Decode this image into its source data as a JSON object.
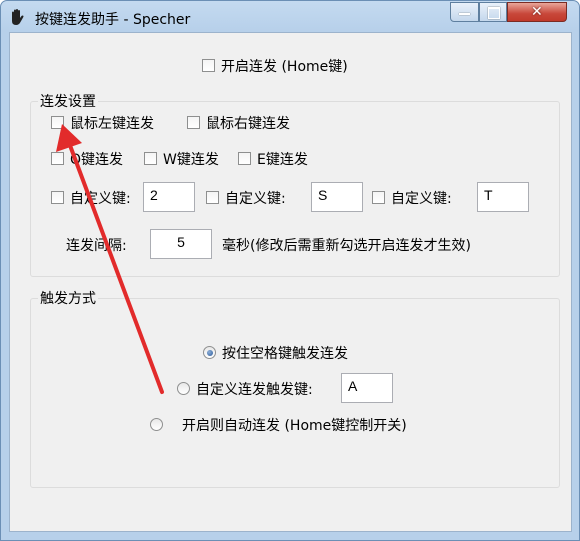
{
  "window": {
    "title": "按键连发助手 - Specher",
    "min_glyph": "—",
    "max_glyph": "□",
    "close_glyph": "✕"
  },
  "top": {
    "enable_label": "开启连发 (Home键)"
  },
  "repeat_settings": {
    "title": "连发设置",
    "mouse_left": "鼠标左键连发",
    "mouse_right": "鼠标右键连发",
    "q_key": "Q键连发",
    "w_key": "W键连发",
    "e_key": "E键连发",
    "custom_label": "自定义键:",
    "custom_values": [
      "2",
      "S",
      "T"
    ],
    "interval_label": "连发间隔:",
    "interval_value": "5",
    "interval_unit": "毫秒(修改后需重新勾选开启连发才生效)"
  },
  "trigger": {
    "title": "触发方式",
    "opt_space": "按住空格键触发连发",
    "opt_custom": "自定义连发触发键:",
    "custom_value": "A",
    "opt_auto": "开启则自动连发 (Home键控制开关)",
    "selected": "opt_space"
  },
  "colors": {
    "arrow": "#e22b2b",
    "close_button": "#c8473a"
  }
}
